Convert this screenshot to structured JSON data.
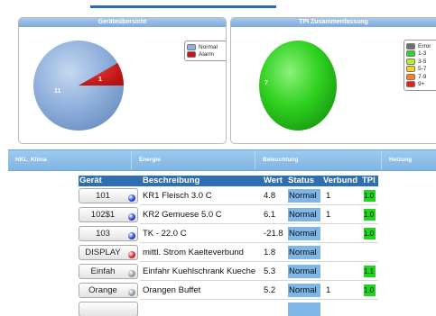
{
  "panels": {
    "left": {
      "title": "Geräteübersicht",
      "pie": {
        "normal_count": "11",
        "alarm_count": "1"
      },
      "legend": [
        {
          "label": "Normal",
          "color": "#8fb1dd"
        },
        {
          "label": "Alarm",
          "color": "#c81414"
        }
      ]
    },
    "right": {
      "title": "TPI Zusammenfassung",
      "pie": {
        "count": "7"
      },
      "legend": [
        {
          "label": "Error",
          "color": "#6f6f6f"
        },
        {
          "label": "1-3",
          "color": "#2bd62b"
        },
        {
          "label": "3-5",
          "color": "#b9ee2e"
        },
        {
          "label": "5-7",
          "color": "#ffcf1f"
        },
        {
          "label": "7-9",
          "color": "#ff7f1f"
        },
        {
          "label": "9+",
          "color": "#ee1b1b"
        }
      ]
    }
  },
  "chart_data": [
    {
      "type": "pie",
      "title": "Geräteübersicht",
      "categories": [
        "Normal",
        "Alarm"
      ],
      "values": [
        11,
        1
      ]
    },
    {
      "type": "pie",
      "title": "TPI Zusammenfassung",
      "categories": [
        "1-3"
      ],
      "values": [
        7
      ]
    }
  ],
  "tabs": [
    "HKL_Klima",
    "Energie",
    "Beleuchtung",
    "Heizung"
  ],
  "table": {
    "headers": {
      "device": "Gerät",
      "description": "Beschreibung",
      "value": "Wert",
      "status": "Status",
      "group": "Verbund",
      "tpi": "TPI"
    },
    "rows": [
      {
        "device": "101",
        "dot": "#1f3fe0",
        "description": "KR1 Fleisch 3.0 C",
        "value": "4.8",
        "status": "Normal",
        "group": "1",
        "tpi": "1.0"
      },
      {
        "device": "102$1",
        "dot": "#1f3fe0",
        "description": "KR2 Gemuese 5.0 C",
        "value": "6.1",
        "status": "Normal",
        "group": "1",
        "tpi": "1.0"
      },
      {
        "device": "103",
        "dot": "#1f3fe0",
        "description": "TK - 22.0 C",
        "value": "-21.8",
        "status": "Normal",
        "group": "",
        "tpi": "1.0"
      },
      {
        "device": "DISPLAY",
        "dot": "#e01f1f",
        "description": "mittl. Strom Kaelteverbund",
        "value": "1.8",
        "status": "Normal",
        "group": "",
        "tpi": ""
      },
      {
        "device": "Einfah",
        "dot": "#8c9aa4",
        "description": "Einfahr Kuehlschrank Kueche",
        "value": "5.3",
        "status": "Normal",
        "group": "",
        "tpi": "1.1"
      },
      {
        "device": "Orange",
        "dot": "#8c9aa4",
        "description": "Orangen Buffet",
        "value": "5.2",
        "status": "Normal",
        "group": "1",
        "tpi": "1.0"
      }
    ]
  }
}
